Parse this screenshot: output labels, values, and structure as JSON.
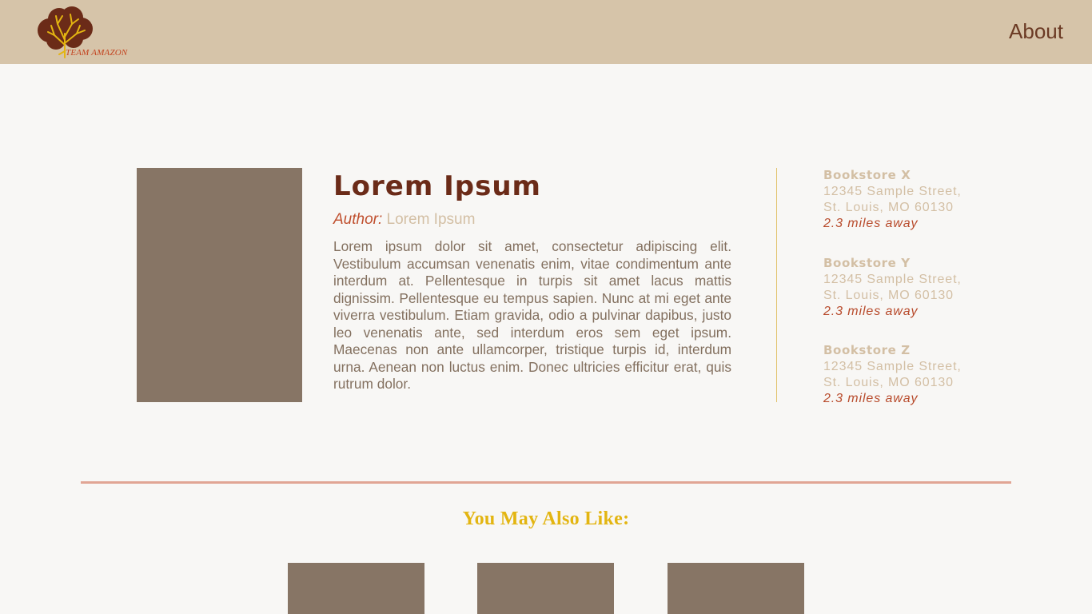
{
  "header": {
    "logo_text": "TEAM AMAZON",
    "nav_about": "About"
  },
  "book": {
    "title": "Lorem Ipsum",
    "author_label": "Author:",
    "author_name": "Lorem Ipsum",
    "description": "Lorem ipsum dolor sit amet, consectetur adipiscing elit. Vestibulum accumsan venenatis enim, vitae condimentum ante interdum at. Pellentesque in turpis sit amet lacus mattis dignissim. Pellentesque eu tempus sapien. Nunc at mi eget ante viverra vestibulum. Etiam gravida, odio a pulvinar dapibus, justo leo venenatis ante, sed interdum eros sem eget ipsum. Maecenas non ante ullamcorper, tristique turpis id, interdum urna. Aenean non luctus enim. Donec ultricies efficitur erat, quis rutrum dolor."
  },
  "stores": [
    {
      "name": "Bookstore X",
      "address_line1": "12345 Sample Street,",
      "address_line2": "St. Louis, MO 60130",
      "distance": "2.3 miles away"
    },
    {
      "name": "Bookstore Y",
      "address_line1": "12345 Sample Street,",
      "address_line2": "St. Louis, MO 60130",
      "distance": "2.3 miles away"
    },
    {
      "name": "Bookstore Z",
      "address_line1": "12345 Sample Street,",
      "address_line2": "St. Louis, MO 60130",
      "distance": "2.3 miles away"
    }
  ],
  "recommendations": {
    "title": "You May Also Like:"
  },
  "colors": {
    "header_bg": "#d6c4a9",
    "page_bg": "#f8f7f5",
    "cover_placeholder": "#877565",
    "title_brown": "#6b2b18",
    "accent_gold": "#e3b511",
    "accent_rust": "#c0502f",
    "divider_pink": "#e1a594"
  },
  "icons": {
    "logo": "tree-icon"
  }
}
